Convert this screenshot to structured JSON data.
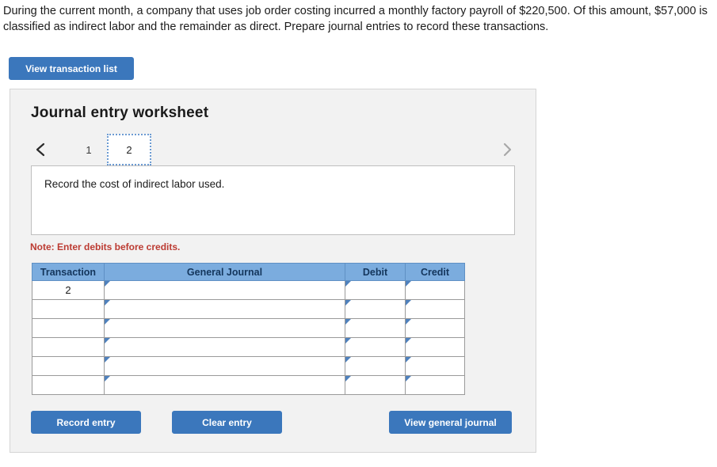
{
  "problem": {
    "statement": "During the current month, a company that uses job order costing incurred a monthly factory payroll of $220,500. Of this amount, $57,000 is classified as indirect labor and the remainder as direct. Prepare journal entries to record these transactions."
  },
  "toolbar": {
    "view_transaction_list_label": "View transaction list"
  },
  "worksheet": {
    "title": "Journal entry worksheet",
    "prev_icon": "chevron-left-icon",
    "next_icon": "chevron-right-icon",
    "tabs": [
      {
        "label": "1",
        "active": false
      },
      {
        "label": "2",
        "active": true
      }
    ],
    "instruction": "Record the cost of indirect labor used.",
    "note": "Note: Enter debits before credits.",
    "table": {
      "headers": [
        "Transaction",
        "General Journal",
        "Debit",
        "Credit"
      ],
      "rows": [
        {
          "transaction": "2",
          "general_journal": "",
          "debit": "",
          "credit": ""
        },
        {
          "transaction": "",
          "general_journal": "",
          "debit": "",
          "credit": ""
        },
        {
          "transaction": "",
          "general_journal": "",
          "debit": "",
          "credit": ""
        },
        {
          "transaction": "",
          "general_journal": "",
          "debit": "",
          "credit": ""
        },
        {
          "transaction": "",
          "general_journal": "",
          "debit": "",
          "credit": ""
        },
        {
          "transaction": "",
          "general_journal": "",
          "debit": "",
          "credit": ""
        }
      ]
    },
    "actions": {
      "record_entry_label": "Record entry",
      "clear_entry_label": "Clear entry",
      "view_general_journal_label": "View general journal"
    }
  },
  "colors": {
    "button_blue": "#3b77bc",
    "table_header_blue": "#7bacde",
    "table_header_text": "#14365c",
    "input_border_blue": "#4f81bd",
    "note_red": "#bc3b32",
    "panel_bg": "#f2f2f2",
    "panel_border": "#d5d5d5"
  }
}
